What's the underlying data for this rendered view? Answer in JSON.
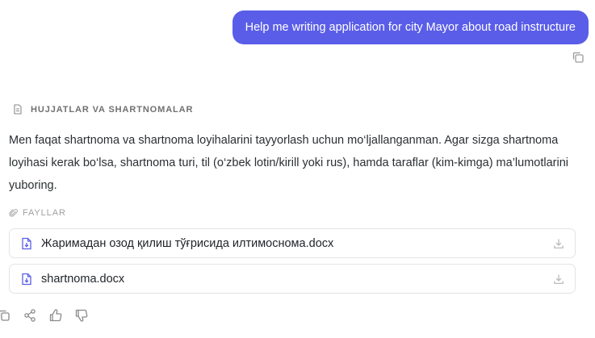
{
  "user_message": {
    "text": "Help me writing application for city Mayor about road instructure"
  },
  "section": {
    "title": "HUJJATLAR VA SHARTNOMALAR"
  },
  "answer": {
    "text": "Men faqat shartnoma va shartnoma loyihalarini tayyorlash uchun mo‘ljallanganman. Agar sizga shartnoma loyihasi kerak bo‘lsa, shartnoma turi, til (o‘zbek lotin/kirill yoki rus), hamda taraflar (kim-kimga) ma’lumotlarini yuboring."
  },
  "files": {
    "label": "FAYLLAR",
    "items": [
      {
        "name": "Жаримадан озод қилиш тўғрисида илтимоснома.docx",
        "icon": "docx-file-icon"
      },
      {
        "name": "shartnoma.docx",
        "icon": "docx-file-icon"
      }
    ]
  },
  "actions": {
    "icons": [
      "copy-icon",
      "share-icon",
      "thumbs-up-icon",
      "thumbs-down-icon"
    ]
  },
  "colors": {
    "user_bubble": "#5a5de8",
    "accent": "#5a5de8",
    "muted": "#a0a0a0"
  }
}
